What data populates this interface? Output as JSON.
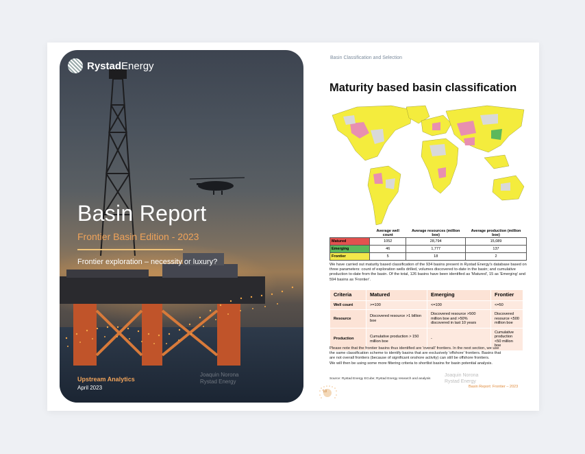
{
  "cover": {
    "brand_strong": "Rystad",
    "brand_light": "Energy",
    "title": "Basin Report",
    "subtitle": "Frontier Basin Edition - 2023",
    "tagline": "Frontier exploration – necessity or luxury?",
    "department": "Upstream Analytics",
    "date": "April 2023",
    "author_1": "Joaquin Norona",
    "author_2": "Rystad Energy"
  },
  "page": {
    "breadcrumb": "Basin Classification and Selection",
    "title": "Maturity based basin classification",
    "summary_table": {
      "headers": [
        "Average well count",
        "Average resources (million boe)",
        "Average production (million boe)"
      ],
      "rows": [
        {
          "label": "Matured",
          "color": "#e2524f",
          "values": [
            "1052",
            "28,794",
            "15,089"
          ]
        },
        {
          "label": "Emerging",
          "color": "#5cb85c",
          "values": [
            "46",
            "1,777",
            "137"
          ]
        },
        {
          "label": "Frontier",
          "color": "#f2e84a",
          "values": [
            "5",
            "18",
            "2"
          ]
        }
      ]
    },
    "paragraph_1": "We have carried out maturity based classification of the 934 basins present in Rystad Energy's database based on three parameters: count of exploration wells drilled, volumes discovered to-date in the basin; and cumulative production to-date from the basin. Of the total, 126 basins have been identified as 'Matured', 15 as 'Emerging' and 594 basins as 'Frontier'.",
    "criteria_table": {
      "headers": [
        "Criteria",
        "Matured",
        "Emerging",
        "Frontier"
      ],
      "rows": [
        [
          "Well count",
          ">=100",
          "<=100",
          "<=50"
        ],
        [
          "Resource",
          "Discovered resource >1 billion boe",
          "Discovered resource >500 million boe and >50% discovered in last 10 years",
          "Discovered resource <500 million boe"
        ],
        [
          "Production",
          "Cumulative production > 150 million boe",
          "-",
          "Cumulative production <50 million boe"
        ]
      ]
    },
    "paragraph_2a": "Please note that the frontier basins thus identified are 'overall' frontiers. In the next section, we use",
    "paragraph_2b": "the same classification scheme to identify basins that are exclusively 'offshore' frontiers. Basins that",
    "paragraph_2c": "are not overall frontiers (because of significant onshore activity) can still be offshore frontiers.",
    "paragraph_2d": "We will then be using some more filtering criteria to shortlist basins for basin potential analysis.",
    "source": "Source: Rystad Energy ECube; Rystad Energy research and analysis",
    "page_number": "10",
    "footer": "Basin Report: Frontier – 2023",
    "author_1": "Joaquin Norona",
    "author_2": "Rystad Energy"
  },
  "colors": {
    "accent_orange": "#f0a35a",
    "matured_red": "#e2524f",
    "emerging_green": "#5cb85c",
    "frontier_yellow": "#f2e84a"
  }
}
